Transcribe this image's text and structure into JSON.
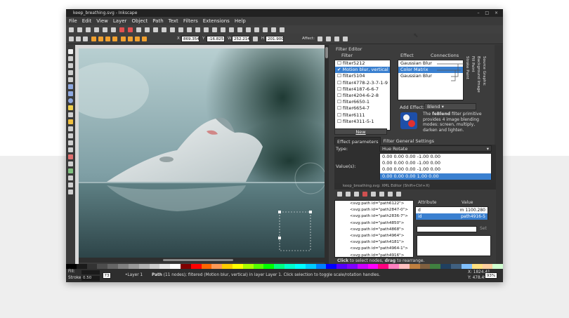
{
  "window": {
    "title": "keep_breathing.svg - Inkscape",
    "controls": "– □ ×"
  },
  "menubar": [
    "File",
    "Edit",
    "View",
    "Layer",
    "Object",
    "Path",
    "Text",
    "Filters",
    "Extensions",
    "Help"
  ],
  "toolbar": {
    "x_label": "X",
    "x_value": "869.354",
    "y_label": "Y",
    "y_value": "-16.825",
    "w_label": "W",
    "w_value": "252.214",
    "h_label": "H",
    "h_value": "201.900",
    "affect_label": "Affect:"
  },
  "filter_editor": {
    "title": "Filter Editor",
    "filter_header": "Filter",
    "filters": [
      {
        "name": "filter5212",
        "checked": false
      },
      {
        "name": "Motion blur, vertical",
        "checked": true,
        "selected": true
      },
      {
        "name": "filter5104",
        "checked": false
      },
      {
        "name": "filter4778-2-3-7-1-9",
        "checked": false
      },
      {
        "name": "filter4187-6-6-7",
        "checked": false
      },
      {
        "name": "filter4204-6-2-8",
        "checked": false
      },
      {
        "name": "filter6650-1",
        "checked": false
      },
      {
        "name": "filter6654-7",
        "checked": false
      },
      {
        "name": "filter6111",
        "checked": false
      },
      {
        "name": "filter4311-5-1",
        "checked": false
      }
    ],
    "new_button": "New",
    "effect_header": "Effect",
    "connections_header": "Connections",
    "effects": [
      {
        "name": "Gaussian Blur",
        "selected": false
      },
      {
        "name": "Color Matrix",
        "selected": true
      },
      {
        "name": "Gaussian Blur",
        "selected": false
      }
    ],
    "side_tabs": [
      "Stroke Paint",
      "Fill Paint",
      "Background Image",
      "Source Graphic"
    ],
    "add_effect_label": "Add Effect:",
    "add_effect_value": "Blend",
    "description_prefix": "The ",
    "description_bold": "feBlend",
    "description_rest": " filter primitive provides 4 image blending modes: screen, multiply, darken and lighten.",
    "tabs": [
      "Effect parameters",
      "Filter General Settings"
    ],
    "type_label": "Type:",
    "type_value": "Hue Rotate",
    "values_label": "Value(s):",
    "matrix_rows": [
      {
        "text": "0.00  0.00  0.00  -1.00  0.00",
        "selected": false
      },
      {
        "text": "0.00  0.00  0.00  -1.00  0.00",
        "selected": false
      },
      {
        "text": "0.00  0.00  0.00  -1.00  0.00",
        "selected": false
      },
      {
        "text": "0.00  0.00  0.00  1.00  0.00",
        "selected": true
      }
    ]
  },
  "xml_editor": {
    "title": "keep_breathing.svg: XML Editor (Shift+Ctrl+X)",
    "nodes": [
      "<svg:path id=\"path6122\">",
      "<svg:path id=\"path2847-0\">",
      "<svg:path id=\"path2836-7\">",
      "<svg:path id=\"path4850\">",
      "<svg:path id=\"path4868\">",
      "<svg:path id=\"path4964\">",
      "<svg:path id=\"path4181\">",
      "<svg:path id=\"path4964-1\">",
      "<svg:path id=\"path4916\">",
      "<svg:path id=\"path4918\">"
    ],
    "attr_header": "Attribute",
    "value_header": "Value",
    "attributes": [
      {
        "name": "d",
        "value": "m 1100.280",
        "selected": false
      },
      {
        "name": "id",
        "value": "path4916-5",
        "selected": true
      }
    ],
    "set_button": "Set"
  },
  "palette": [
    "#000000",
    "#1a1a1a",
    "#333333",
    "#4d4d4d",
    "#666666",
    "#808080",
    "#999999",
    "#b3b3b3",
    "#cccccc",
    "#e6e6e6",
    "#ffffff",
    "#800000",
    "#ff0000",
    "#ff6600",
    "#ff9955",
    "#ffcc00",
    "#ffff00",
    "#aaff00",
    "#55ff00",
    "#00ff00",
    "#00ff80",
    "#00ffcc",
    "#00ffff",
    "#00ccff",
    "#0080ff",
    "#0000ff",
    "#5500ff",
    "#8000ff",
    "#cc00ff",
    "#ff00ff",
    "#ff0080",
    "#ff80c0",
    "#ffc0c0",
    "#c08040",
    "#806040",
    "#408040",
    "#204060",
    "#406080",
    "#80c0ff",
    "#ffe080",
    "#ffd0a0",
    "#d0ffd0"
  ],
  "status": {
    "fill_label": "Fill:",
    "stroke_label": "Stroke:",
    "stroke_width": "0.50",
    "opacity": "73",
    "layer": "•Layer 1",
    "message_bold": "Path",
    "message": " (11 nodes); filtered (Motion blur, vertical) in layer Layer 1. Click selection to toggle scale/rotation handles.",
    "hint_bold1": "Click",
    "hint1": " to select nodes, ",
    "hint_bold2": "drag",
    "hint2": " to rearrange.",
    "coord_x": "X: 1824.41",
    "coord_y": "Y:  478.49",
    "zoom": "93%"
  }
}
